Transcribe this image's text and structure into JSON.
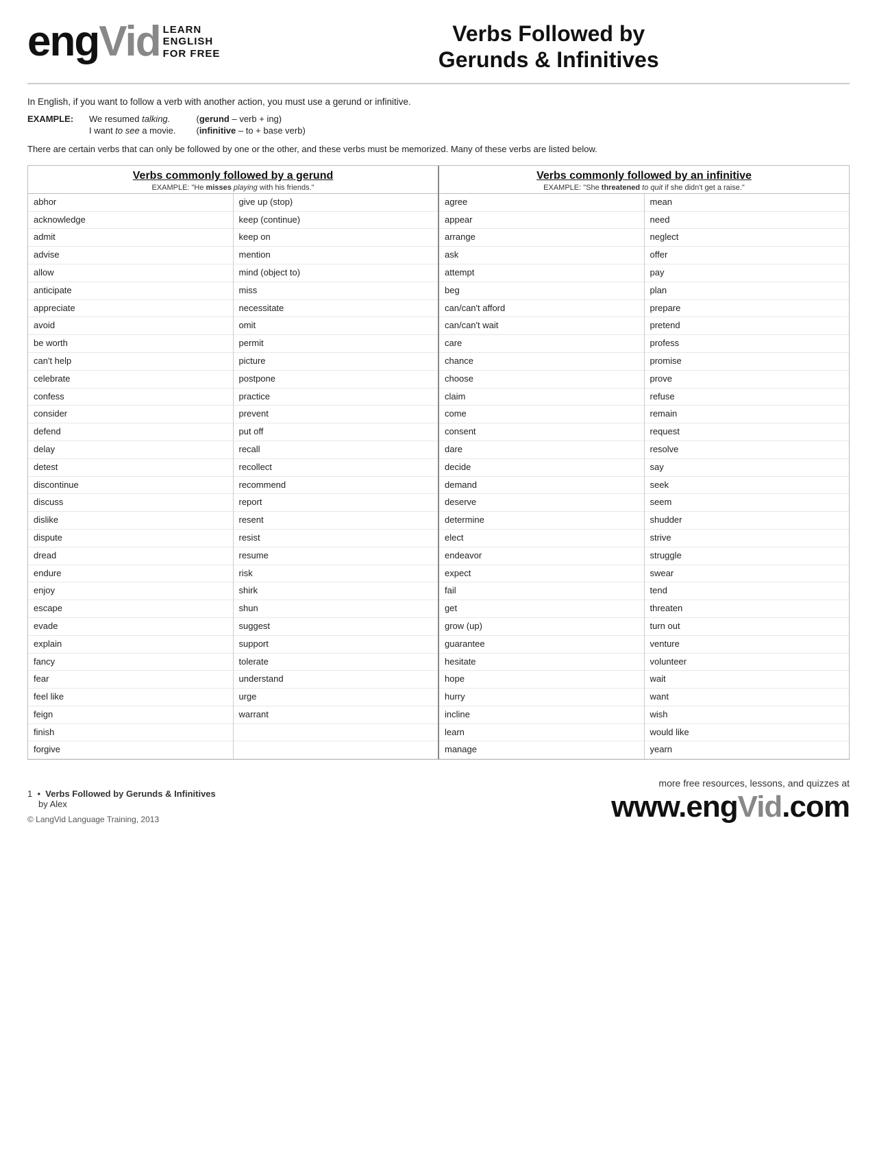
{
  "logo": {
    "eng": "eng",
    "vid": "Vid",
    "learn": "LEARN",
    "english": "ENGLISH",
    "forfree": "FOR FREE"
  },
  "title": "Verbs Followed by",
  "title2": "Gerunds & Infinitives",
  "intro": "In English, if you want to follow a verb with another action, you must use a gerund or infinitive.",
  "example_label": "EXAMPLE:",
  "example_s1": "We resumed ",
  "example_s1_italic": "talking.",
  "example_s2": "I want ",
  "example_s2_italic": "to see",
  "example_s2_rest": " a movie.",
  "example_def1_pre": "(",
  "example_def1_bold": "gerund",
  "example_def1_post": " – verb + ing)",
  "example_def2_pre": "(",
  "example_def2_bold": "infinitive",
  "example_def2_post": " – to + base verb)",
  "body_text": "There are certain verbs that can only be followed by one or the other, and these verbs must be memorized. Many of these verbs are listed below.",
  "gerund_section": {
    "title": "Verbs commonly followed by a gerund",
    "example": "EXAMPLE: \"He misses playing with his friends.\"",
    "example_bold": "misses",
    "example_italic": "playing",
    "col1": [
      "abhor",
      "acknowledge",
      "admit",
      "advise",
      "allow",
      "anticipate",
      "appreciate",
      "avoid",
      "be worth",
      "can't help",
      "celebrate",
      "confess",
      "consider",
      "defend",
      "delay",
      "detest",
      "discontinue",
      "discuss",
      "dislike",
      "dispute",
      "dread",
      "endure",
      "enjoy",
      "escape",
      "evade",
      "explain",
      "fancy",
      "fear",
      "feel like",
      "feign",
      "finish",
      "forgive"
    ],
    "col2": [
      "give up (stop)",
      "keep (continue)",
      "keep on",
      "mention",
      "mind (object to)",
      "miss",
      "necessitate",
      "omit",
      "permit",
      "picture",
      "postpone",
      "practice",
      "prevent",
      "put off",
      "recall",
      "recollect",
      "recommend",
      "report",
      "resent",
      "resist",
      "resume",
      "risk",
      "shirk",
      "shun",
      "suggest",
      "support",
      "tolerate",
      "understand",
      "urge",
      "warrant",
      "",
      ""
    ]
  },
  "infinitive_section": {
    "title": "Verbs commonly followed by an infinitive",
    "example": "EXAMPLE: \"She threatened to quit if she didn't get a raise.\"",
    "example_bold": "threatened",
    "example_italic": "to quit",
    "col1": [
      "agree",
      "appear",
      "arrange",
      "ask",
      "attempt",
      "beg",
      "can/can't afford",
      "can/can't wait",
      "care",
      "chance",
      "choose",
      "claim",
      "come",
      "consent",
      "dare",
      "decide",
      "demand",
      "deserve",
      "determine",
      "elect",
      "endeavor",
      "expect",
      "fail",
      "get",
      "grow (up)",
      "guarantee",
      "hesitate",
      "hope",
      "hurry",
      "incline",
      "learn",
      "manage"
    ],
    "col2": [
      "mean",
      "need",
      "neglect",
      "offer",
      "pay",
      "plan",
      "prepare",
      "pretend",
      "profess",
      "promise",
      "prove",
      "refuse",
      "remain",
      "request",
      "resolve",
      "say",
      "seek",
      "seem",
      "shudder",
      "strive",
      "struggle",
      "swear",
      "tend",
      "threaten",
      "turn out",
      "venture",
      "volunteer",
      "wait",
      "want",
      "wish",
      "would like",
      "yearn"
    ]
  },
  "footer": {
    "number": "1",
    "bullet": "•",
    "lesson_title": "Verbs Followed by Gerunds & Infinitives",
    "by": "by Alex",
    "copyright": "© LangVid Language Training, 2013",
    "more_text": "more free resources, lessons, and quizzes at",
    "website": "www.engVid.com"
  }
}
